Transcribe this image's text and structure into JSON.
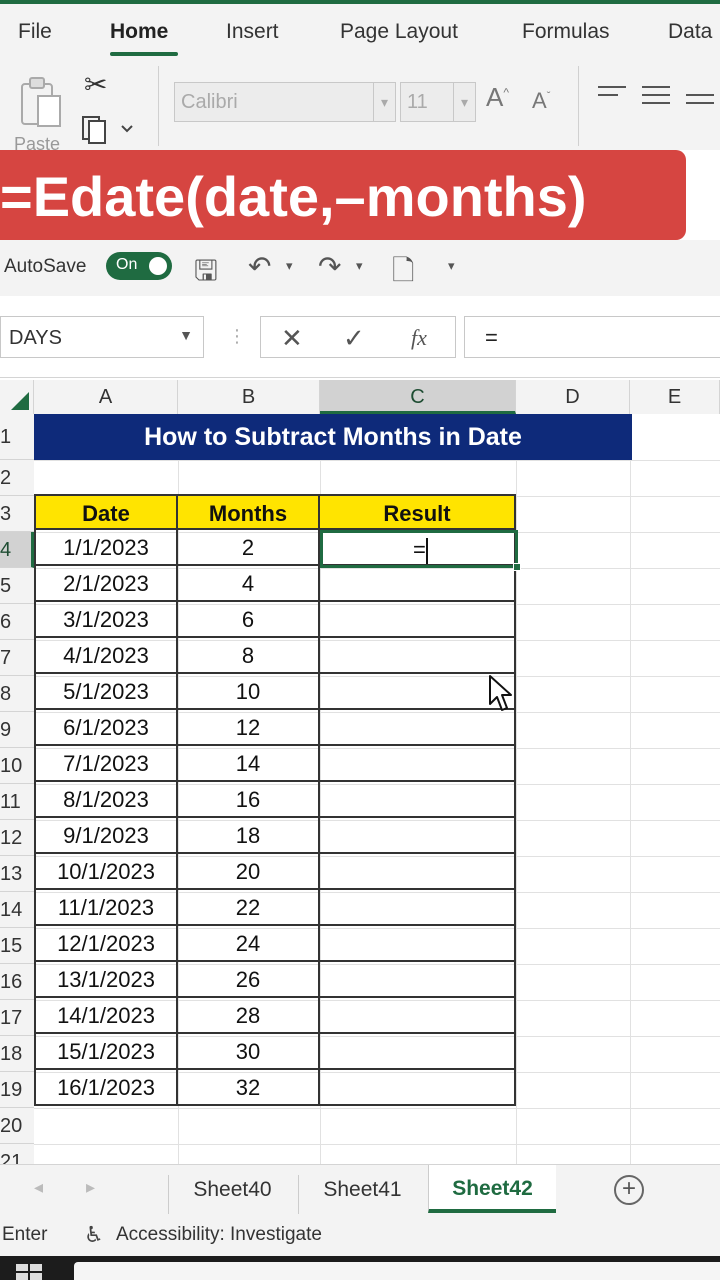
{
  "ribbon": {
    "tabs": [
      "File",
      "Home",
      "Insert",
      "Page Layout",
      "Formulas",
      "Data"
    ],
    "active_tab": "Home",
    "paste_label": "Paste",
    "font_name": "Calibri",
    "font_size": "11"
  },
  "banner": {
    "text": "=Edate(date,–months)",
    "color": "#d64541"
  },
  "quick_access": {
    "autosave_label": "AutoSave",
    "autosave_state": "On"
  },
  "formula_bar": {
    "name_box": "DAYS",
    "fx_label": "fx",
    "content": "="
  },
  "grid": {
    "columns": [
      "A",
      "B",
      "C",
      "D",
      "E"
    ],
    "selected_column": "C",
    "rows": [
      "1",
      "2",
      "3",
      "4",
      "5",
      "6",
      "7",
      "8",
      "9",
      "10",
      "11",
      "12",
      "13",
      "14",
      "15",
      "16",
      "17",
      "18",
      "19",
      "20",
      "21"
    ],
    "selected_row": "4",
    "title": "How to Subtract Months in Date",
    "headers": [
      "Date",
      "Months",
      "Result"
    ],
    "data": [
      [
        "1/1/2023",
        "2"
      ],
      [
        "2/1/2023",
        "4"
      ],
      [
        "3/1/2023",
        "6"
      ],
      [
        "4/1/2023",
        "8"
      ],
      [
        "5/1/2023",
        "10"
      ],
      [
        "6/1/2023",
        "12"
      ],
      [
        "7/1/2023",
        "14"
      ],
      [
        "8/1/2023",
        "16"
      ],
      [
        "9/1/2023",
        "18"
      ],
      [
        "10/1/2023",
        "20"
      ],
      [
        "11/1/2023",
        "22"
      ],
      [
        "12/1/2023",
        "24"
      ],
      [
        "13/1/2023",
        "26"
      ],
      [
        "14/1/2023",
        "28"
      ],
      [
        "15/1/2023",
        "30"
      ],
      [
        "16/1/2023",
        "32"
      ]
    ],
    "active_cell_text": "="
  },
  "sheets": {
    "tabs": [
      "Sheet40",
      "Sheet41",
      "Sheet42"
    ],
    "active": "Sheet42"
  },
  "status": {
    "mode": "Enter",
    "accessibility": "Accessibility: Investigate"
  },
  "colors": {
    "excel_green": "#1f6b41",
    "title_fill": "#0e2a7a",
    "header_fill": "#ffe400"
  }
}
